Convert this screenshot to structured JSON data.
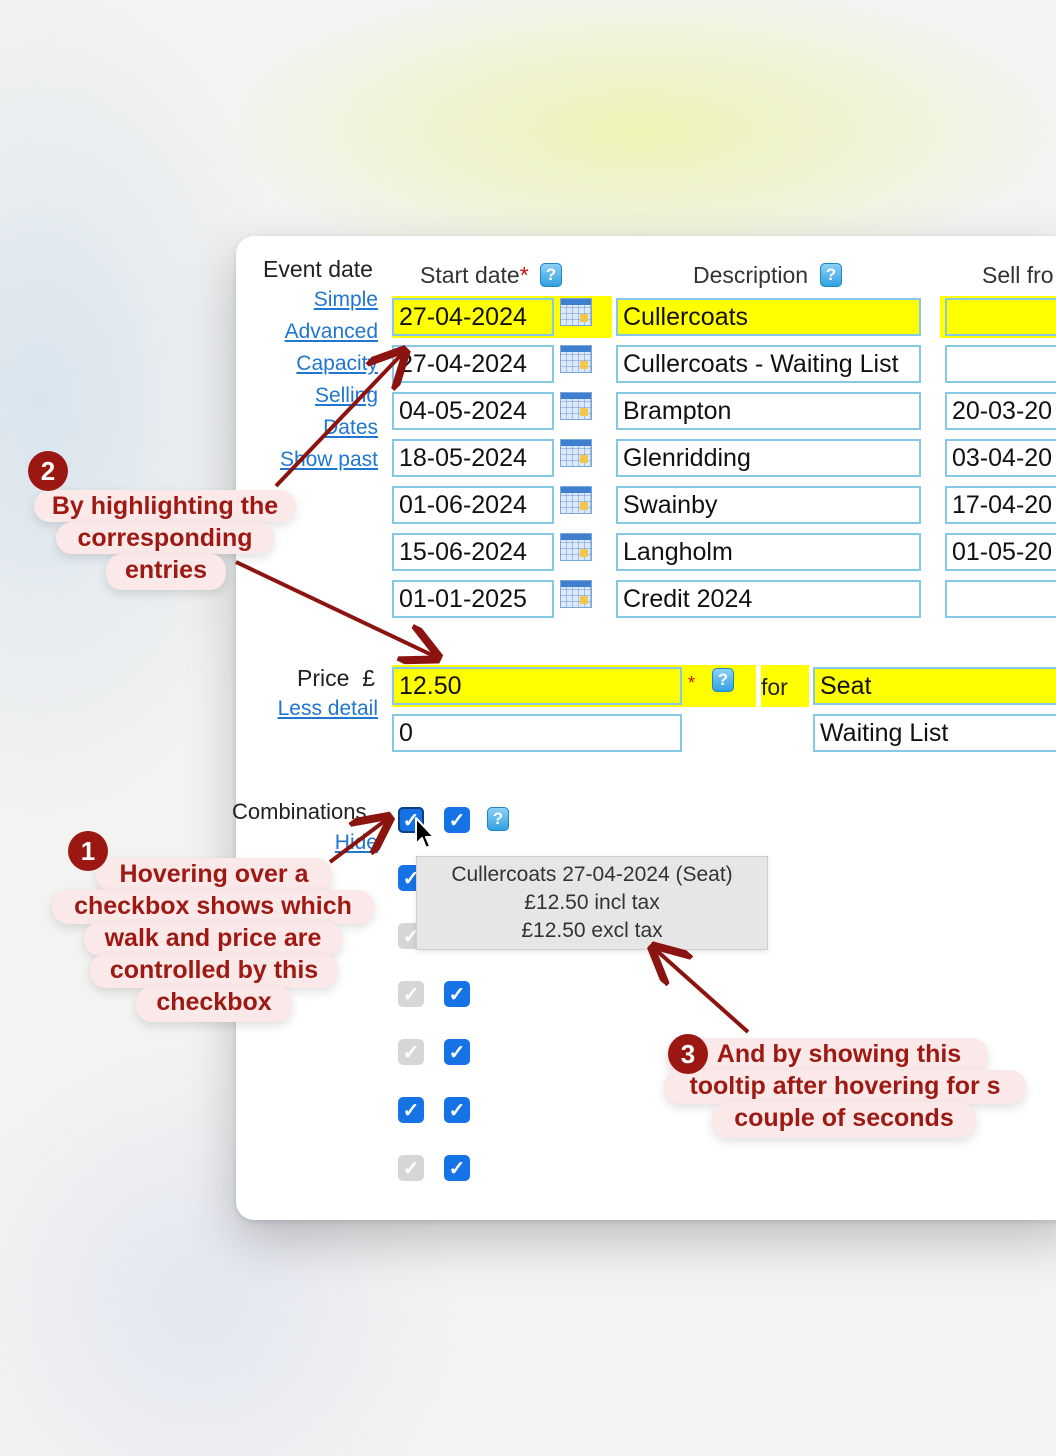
{
  "sidebar": {
    "event_date_label": "Event date",
    "links": [
      "Simple",
      "Advanced",
      "Capacity",
      "Selling",
      "Dates",
      "Show past"
    ]
  },
  "columns": {
    "start_date": "Start date",
    "required_mark": "*",
    "description": "Description",
    "sell_from": "Sell fro"
  },
  "rows": [
    {
      "start": "27-04-2024",
      "desc": "Cullercoats",
      "sell": "",
      "highlight": true
    },
    {
      "start": "27-04-2024",
      "desc": "Cullercoats - Waiting List",
      "sell": ""
    },
    {
      "start": "04-05-2024",
      "desc": "Brampton",
      "sell": "20-03-20"
    },
    {
      "start": "18-05-2024",
      "desc": "Glenridding",
      "sell": "03-04-20"
    },
    {
      "start": "01-06-2024",
      "desc": "Swainby",
      "sell": "17-04-20"
    },
    {
      "start": "15-06-2024",
      "desc": "Langholm",
      "sell": "01-05-20"
    },
    {
      "start": "01-01-2025",
      "desc": "Credit 2024",
      "sell": ""
    }
  ],
  "price": {
    "label": "Price",
    "currency": "£",
    "less_detail": "Less detail",
    "values": [
      "12.50",
      "0"
    ],
    "required_mark": "*",
    "for_label": "for",
    "types": [
      "Seat",
      "Waiting List"
    ]
  },
  "combinations": {
    "label": "Combinations",
    "hide": "Hide",
    "checkbox_rows": [
      {
        "a": "checked",
        "b": "checked"
      },
      {
        "a": "checked",
        "b": ""
      },
      {
        "a": "disabled",
        "b": ""
      },
      {
        "a": "disabled",
        "b": "checked"
      },
      {
        "a": "disabled",
        "b": "checked"
      },
      {
        "a": "checked",
        "b": "checked"
      },
      {
        "a": "disabled",
        "b": "checked"
      }
    ]
  },
  "tooltip": {
    "line1": "Cullercoats 27-04-2024 (Seat)",
    "line2": "£12.50 incl tax",
    "line3": "£12.50 excl tax"
  },
  "annotations": [
    {
      "number": "1",
      "lines": [
        "Hovering  over a",
        "checkbox shows which",
        "walk and price are",
        "controlled by this",
        "checkbox"
      ]
    },
    {
      "number": "2",
      "lines": [
        "By highlighting the",
        "corresponding",
        "entries"
      ]
    },
    {
      "number": "3",
      "lines": [
        "And by showing this",
        "tooltip after hovering for s",
        "couple of seconds"
      ]
    }
  ],
  "colors": {
    "highlight": "#ffff00",
    "field_border": "#86c8e8",
    "checkbox": "#1673e6",
    "annotation_text": "#9d1a14",
    "annotation_bubble": "#fbe9e9",
    "link": "#1f77d0"
  }
}
